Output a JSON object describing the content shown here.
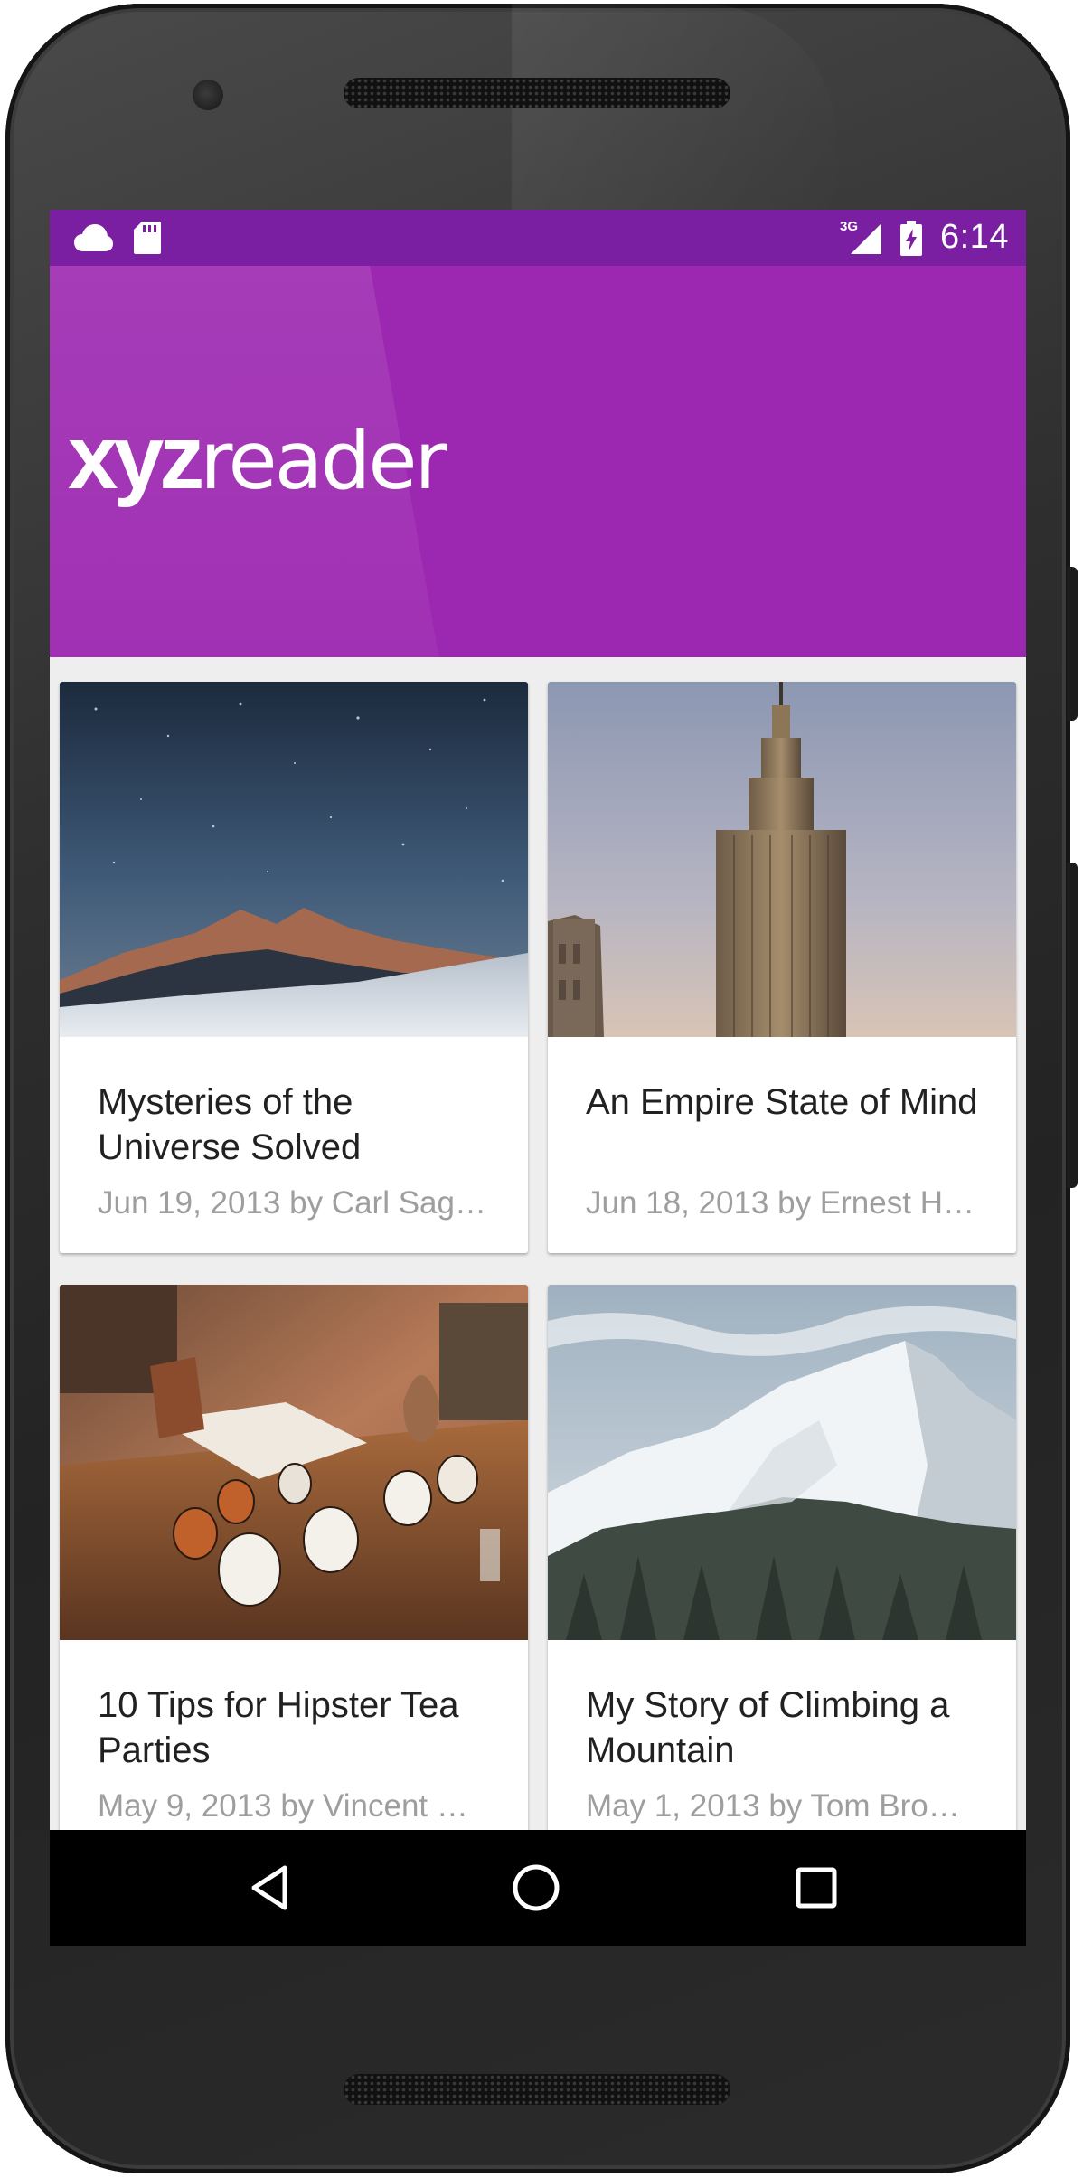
{
  "status_bar": {
    "time": "6:14",
    "network": "3G",
    "left_icons": [
      "cloud-icon",
      "sd-card-icon"
    ],
    "right_icons": [
      "signal-icon",
      "battery-icon"
    ]
  },
  "toolbar": {
    "logo_strong": "xyz",
    "logo_light": "reader",
    "color": "#9c27b0",
    "status_color": "#7b1fa2"
  },
  "articles": [
    {
      "title": "Mysteries of the Universe Solved",
      "meta": "Jun 19, 2013 by Carl Sag…",
      "image": "starry-mountain-night"
    },
    {
      "title": "An Empire State of Mind",
      "meta": "Jun 18, 2013 by Ernest H…",
      "image": "empire-state-building"
    },
    {
      "title": "10 Tips for Hipster Tea Parties",
      "meta": "May 9, 2013 by Vincent …",
      "image": "tea-cups-on-table"
    },
    {
      "title": "My Story of Climbing a Mountain",
      "meta": "May 1, 2013 by Tom Bro…",
      "image": "snowy-mountain"
    }
  ],
  "nav_bar": {
    "buttons": [
      "back-icon",
      "home-icon",
      "recents-icon"
    ]
  }
}
